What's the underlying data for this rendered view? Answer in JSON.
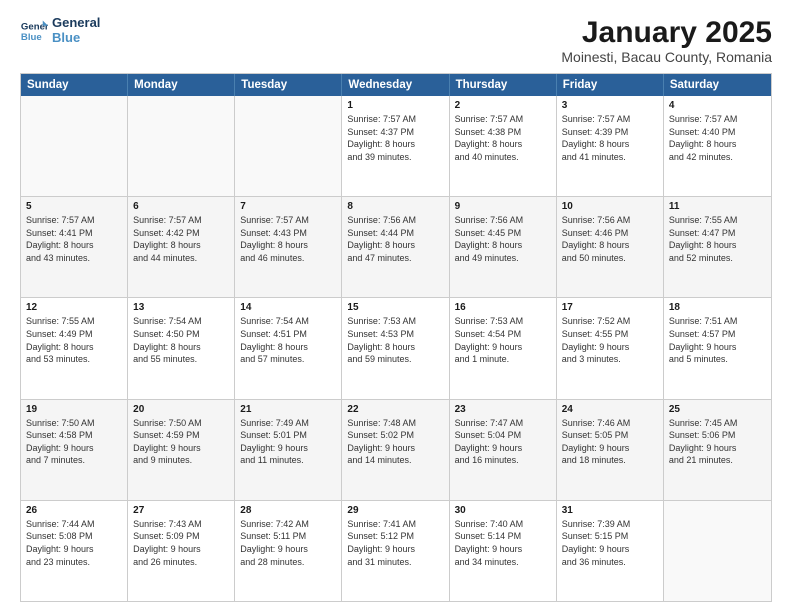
{
  "logo": {
    "line1": "General",
    "line2": "Blue"
  },
  "title": "January 2025",
  "subtitle": "Moinesti, Bacau County, Romania",
  "days": [
    "Sunday",
    "Monday",
    "Tuesday",
    "Wednesday",
    "Thursday",
    "Friday",
    "Saturday"
  ],
  "weeks": [
    [
      {
        "day": "",
        "text": ""
      },
      {
        "day": "",
        "text": ""
      },
      {
        "day": "",
        "text": ""
      },
      {
        "day": "1",
        "text": "Sunrise: 7:57 AM\nSunset: 4:37 PM\nDaylight: 8 hours\nand 39 minutes."
      },
      {
        "day": "2",
        "text": "Sunrise: 7:57 AM\nSunset: 4:38 PM\nDaylight: 8 hours\nand 40 minutes."
      },
      {
        "day": "3",
        "text": "Sunrise: 7:57 AM\nSunset: 4:39 PM\nDaylight: 8 hours\nand 41 minutes."
      },
      {
        "day": "4",
        "text": "Sunrise: 7:57 AM\nSunset: 4:40 PM\nDaylight: 8 hours\nand 42 minutes."
      }
    ],
    [
      {
        "day": "5",
        "text": "Sunrise: 7:57 AM\nSunset: 4:41 PM\nDaylight: 8 hours\nand 43 minutes."
      },
      {
        "day": "6",
        "text": "Sunrise: 7:57 AM\nSunset: 4:42 PM\nDaylight: 8 hours\nand 44 minutes."
      },
      {
        "day": "7",
        "text": "Sunrise: 7:57 AM\nSunset: 4:43 PM\nDaylight: 8 hours\nand 46 minutes."
      },
      {
        "day": "8",
        "text": "Sunrise: 7:56 AM\nSunset: 4:44 PM\nDaylight: 8 hours\nand 47 minutes."
      },
      {
        "day": "9",
        "text": "Sunrise: 7:56 AM\nSunset: 4:45 PM\nDaylight: 8 hours\nand 49 minutes."
      },
      {
        "day": "10",
        "text": "Sunrise: 7:56 AM\nSunset: 4:46 PM\nDaylight: 8 hours\nand 50 minutes."
      },
      {
        "day": "11",
        "text": "Sunrise: 7:55 AM\nSunset: 4:47 PM\nDaylight: 8 hours\nand 52 minutes."
      }
    ],
    [
      {
        "day": "12",
        "text": "Sunrise: 7:55 AM\nSunset: 4:49 PM\nDaylight: 8 hours\nand 53 minutes."
      },
      {
        "day": "13",
        "text": "Sunrise: 7:54 AM\nSunset: 4:50 PM\nDaylight: 8 hours\nand 55 minutes."
      },
      {
        "day": "14",
        "text": "Sunrise: 7:54 AM\nSunset: 4:51 PM\nDaylight: 8 hours\nand 57 minutes."
      },
      {
        "day": "15",
        "text": "Sunrise: 7:53 AM\nSunset: 4:53 PM\nDaylight: 8 hours\nand 59 minutes."
      },
      {
        "day": "16",
        "text": "Sunrise: 7:53 AM\nSunset: 4:54 PM\nDaylight: 9 hours\nand 1 minute."
      },
      {
        "day": "17",
        "text": "Sunrise: 7:52 AM\nSunset: 4:55 PM\nDaylight: 9 hours\nand 3 minutes."
      },
      {
        "day": "18",
        "text": "Sunrise: 7:51 AM\nSunset: 4:57 PM\nDaylight: 9 hours\nand 5 minutes."
      }
    ],
    [
      {
        "day": "19",
        "text": "Sunrise: 7:50 AM\nSunset: 4:58 PM\nDaylight: 9 hours\nand 7 minutes."
      },
      {
        "day": "20",
        "text": "Sunrise: 7:50 AM\nSunset: 4:59 PM\nDaylight: 9 hours\nand 9 minutes."
      },
      {
        "day": "21",
        "text": "Sunrise: 7:49 AM\nSunset: 5:01 PM\nDaylight: 9 hours\nand 11 minutes."
      },
      {
        "day": "22",
        "text": "Sunrise: 7:48 AM\nSunset: 5:02 PM\nDaylight: 9 hours\nand 14 minutes."
      },
      {
        "day": "23",
        "text": "Sunrise: 7:47 AM\nSunset: 5:04 PM\nDaylight: 9 hours\nand 16 minutes."
      },
      {
        "day": "24",
        "text": "Sunrise: 7:46 AM\nSunset: 5:05 PM\nDaylight: 9 hours\nand 18 minutes."
      },
      {
        "day": "25",
        "text": "Sunrise: 7:45 AM\nSunset: 5:06 PM\nDaylight: 9 hours\nand 21 minutes."
      }
    ],
    [
      {
        "day": "26",
        "text": "Sunrise: 7:44 AM\nSunset: 5:08 PM\nDaylight: 9 hours\nand 23 minutes."
      },
      {
        "day": "27",
        "text": "Sunrise: 7:43 AM\nSunset: 5:09 PM\nDaylight: 9 hours\nand 26 minutes."
      },
      {
        "day": "28",
        "text": "Sunrise: 7:42 AM\nSunset: 5:11 PM\nDaylight: 9 hours\nand 28 minutes."
      },
      {
        "day": "29",
        "text": "Sunrise: 7:41 AM\nSunset: 5:12 PM\nDaylight: 9 hours\nand 31 minutes."
      },
      {
        "day": "30",
        "text": "Sunrise: 7:40 AM\nSunset: 5:14 PM\nDaylight: 9 hours\nand 34 minutes."
      },
      {
        "day": "31",
        "text": "Sunrise: 7:39 AM\nSunset: 5:15 PM\nDaylight: 9 hours\nand 36 minutes."
      },
      {
        "day": "",
        "text": ""
      }
    ]
  ]
}
